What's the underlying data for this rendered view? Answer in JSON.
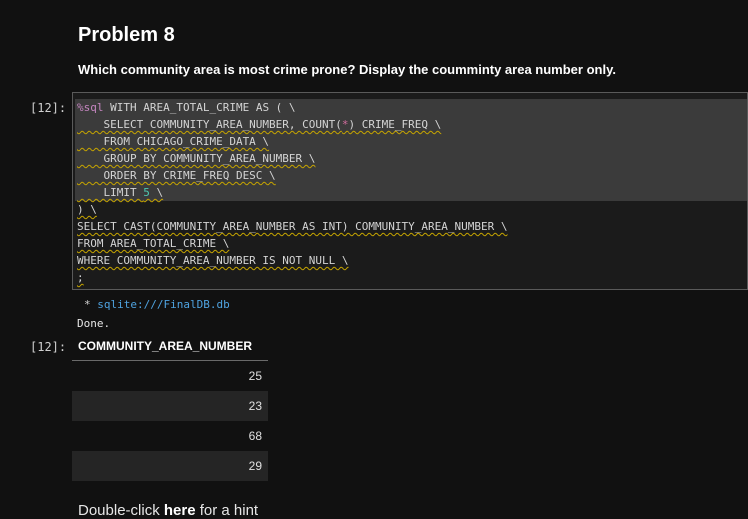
{
  "markdown": {
    "title": "Problem 8",
    "question": "Which community area is most crime prone? Display the coumminty area number only."
  },
  "code_cell": {
    "prompt": "[12]:",
    "lines": {
      "l1_magic": "%sql",
      "l1_rest": " WITH AREA_TOTAL_CRIME AS ( \\",
      "l2_a": "    SELECT COMMUNITY_AREA_NUMBER, COUNT(",
      "l2_star": "*",
      "l2_b": ") CRIME_FREQ \\",
      "l3": "    FROM CHICAGO_CRIME_DATA \\",
      "l4": "    GROUP BY COMMUNITY_AREA_NUMBER \\",
      "l5": "    ORDER BY CRIME_FREQ DESC \\",
      "l6_a": "    LIMIT ",
      "l6_num": "5",
      "l6_b": " \\",
      "l7": ") \\",
      "l8": "SELECT CAST(COMMUNITY_AREA_NUMBER AS INT) COMMUNITY_AREA_NUMBER \\",
      "l9": "FROM AREA_TOTAL_CRIME \\",
      "l10": "WHERE COMMUNITY_AREA_NUMBER IS NOT NULL \\",
      "l11": ";"
    }
  },
  "output": {
    "prompt": "[12]:",
    "connection_bullet": " * ",
    "connection_url": "sqlite:///FinalDB.db",
    "done_text": "Done.",
    "table": {
      "header": "COMMUNITY_AREA_NUMBER",
      "rows": [
        "25",
        "23",
        "68",
        "29"
      ]
    }
  },
  "hint": {
    "prefix": "Double-click ",
    "bold": "here",
    "suffix": " for a hint"
  }
}
